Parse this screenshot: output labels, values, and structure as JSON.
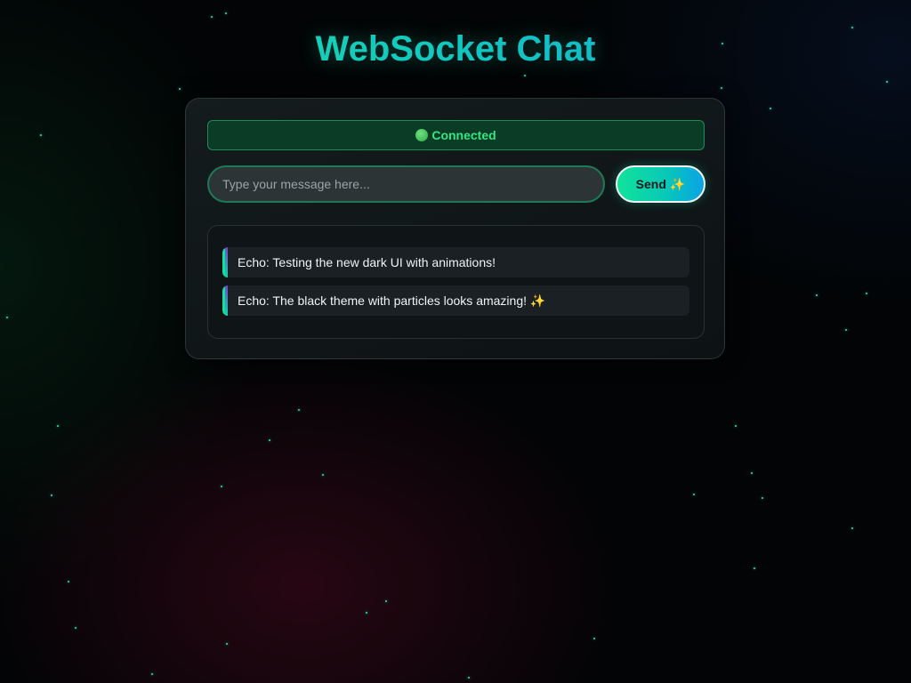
{
  "page": {
    "title": "WebSocket Chat",
    "accent_color": "#10e39a",
    "secondary_accent": "#0aa3e6"
  },
  "status": {
    "icon": "green-circle-icon",
    "text": "Connected",
    "color": "#35e584"
  },
  "composer": {
    "placeholder": "Type your message here...",
    "value": "",
    "send_label": "Send",
    "send_icon": "sparkles-icon",
    "send_icon_glyph": "✨"
  },
  "messages": [
    {
      "text": "Echo: Testing the new dark UI with animations!"
    },
    {
      "text": "Echo: The black theme with particles looks amazing!",
      "trailing_glyph": "✨"
    }
  ]
}
